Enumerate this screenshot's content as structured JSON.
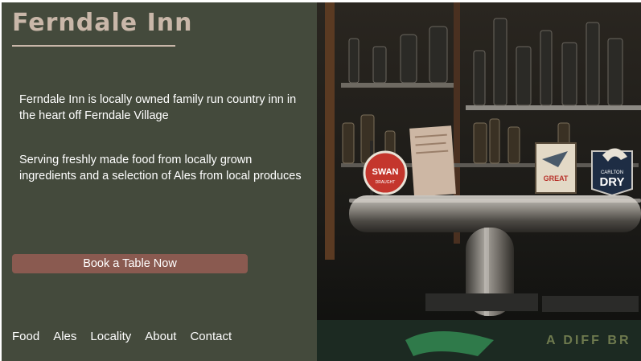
{
  "site": {
    "title": "Ferndale Inn"
  },
  "intro": {
    "paragraph_1": "Ferndale Inn is locally owned family run country inn in the heart off Ferndale Village",
    "paragraph_2": "Serving freshly made food from locally grown ingredients and a  selection of Ales from local produces"
  },
  "cta": {
    "book_label": "Book a Table Now"
  },
  "nav": {
    "items": [
      "Food",
      "Ales",
      "Locality",
      "About",
      "Contact"
    ]
  },
  "hero_image": {
    "badges": {
      "swan": "SWAN",
      "swan_sub": "DRAUGHT",
      "great": "GREAT",
      "carlton": "CARLTON",
      "dry": "DRY"
    },
    "mat_text": "A DIFF BR"
  },
  "colors": {
    "panel": "#444a3c",
    "title": "#c9b7a9",
    "button": "#8a5a50"
  }
}
